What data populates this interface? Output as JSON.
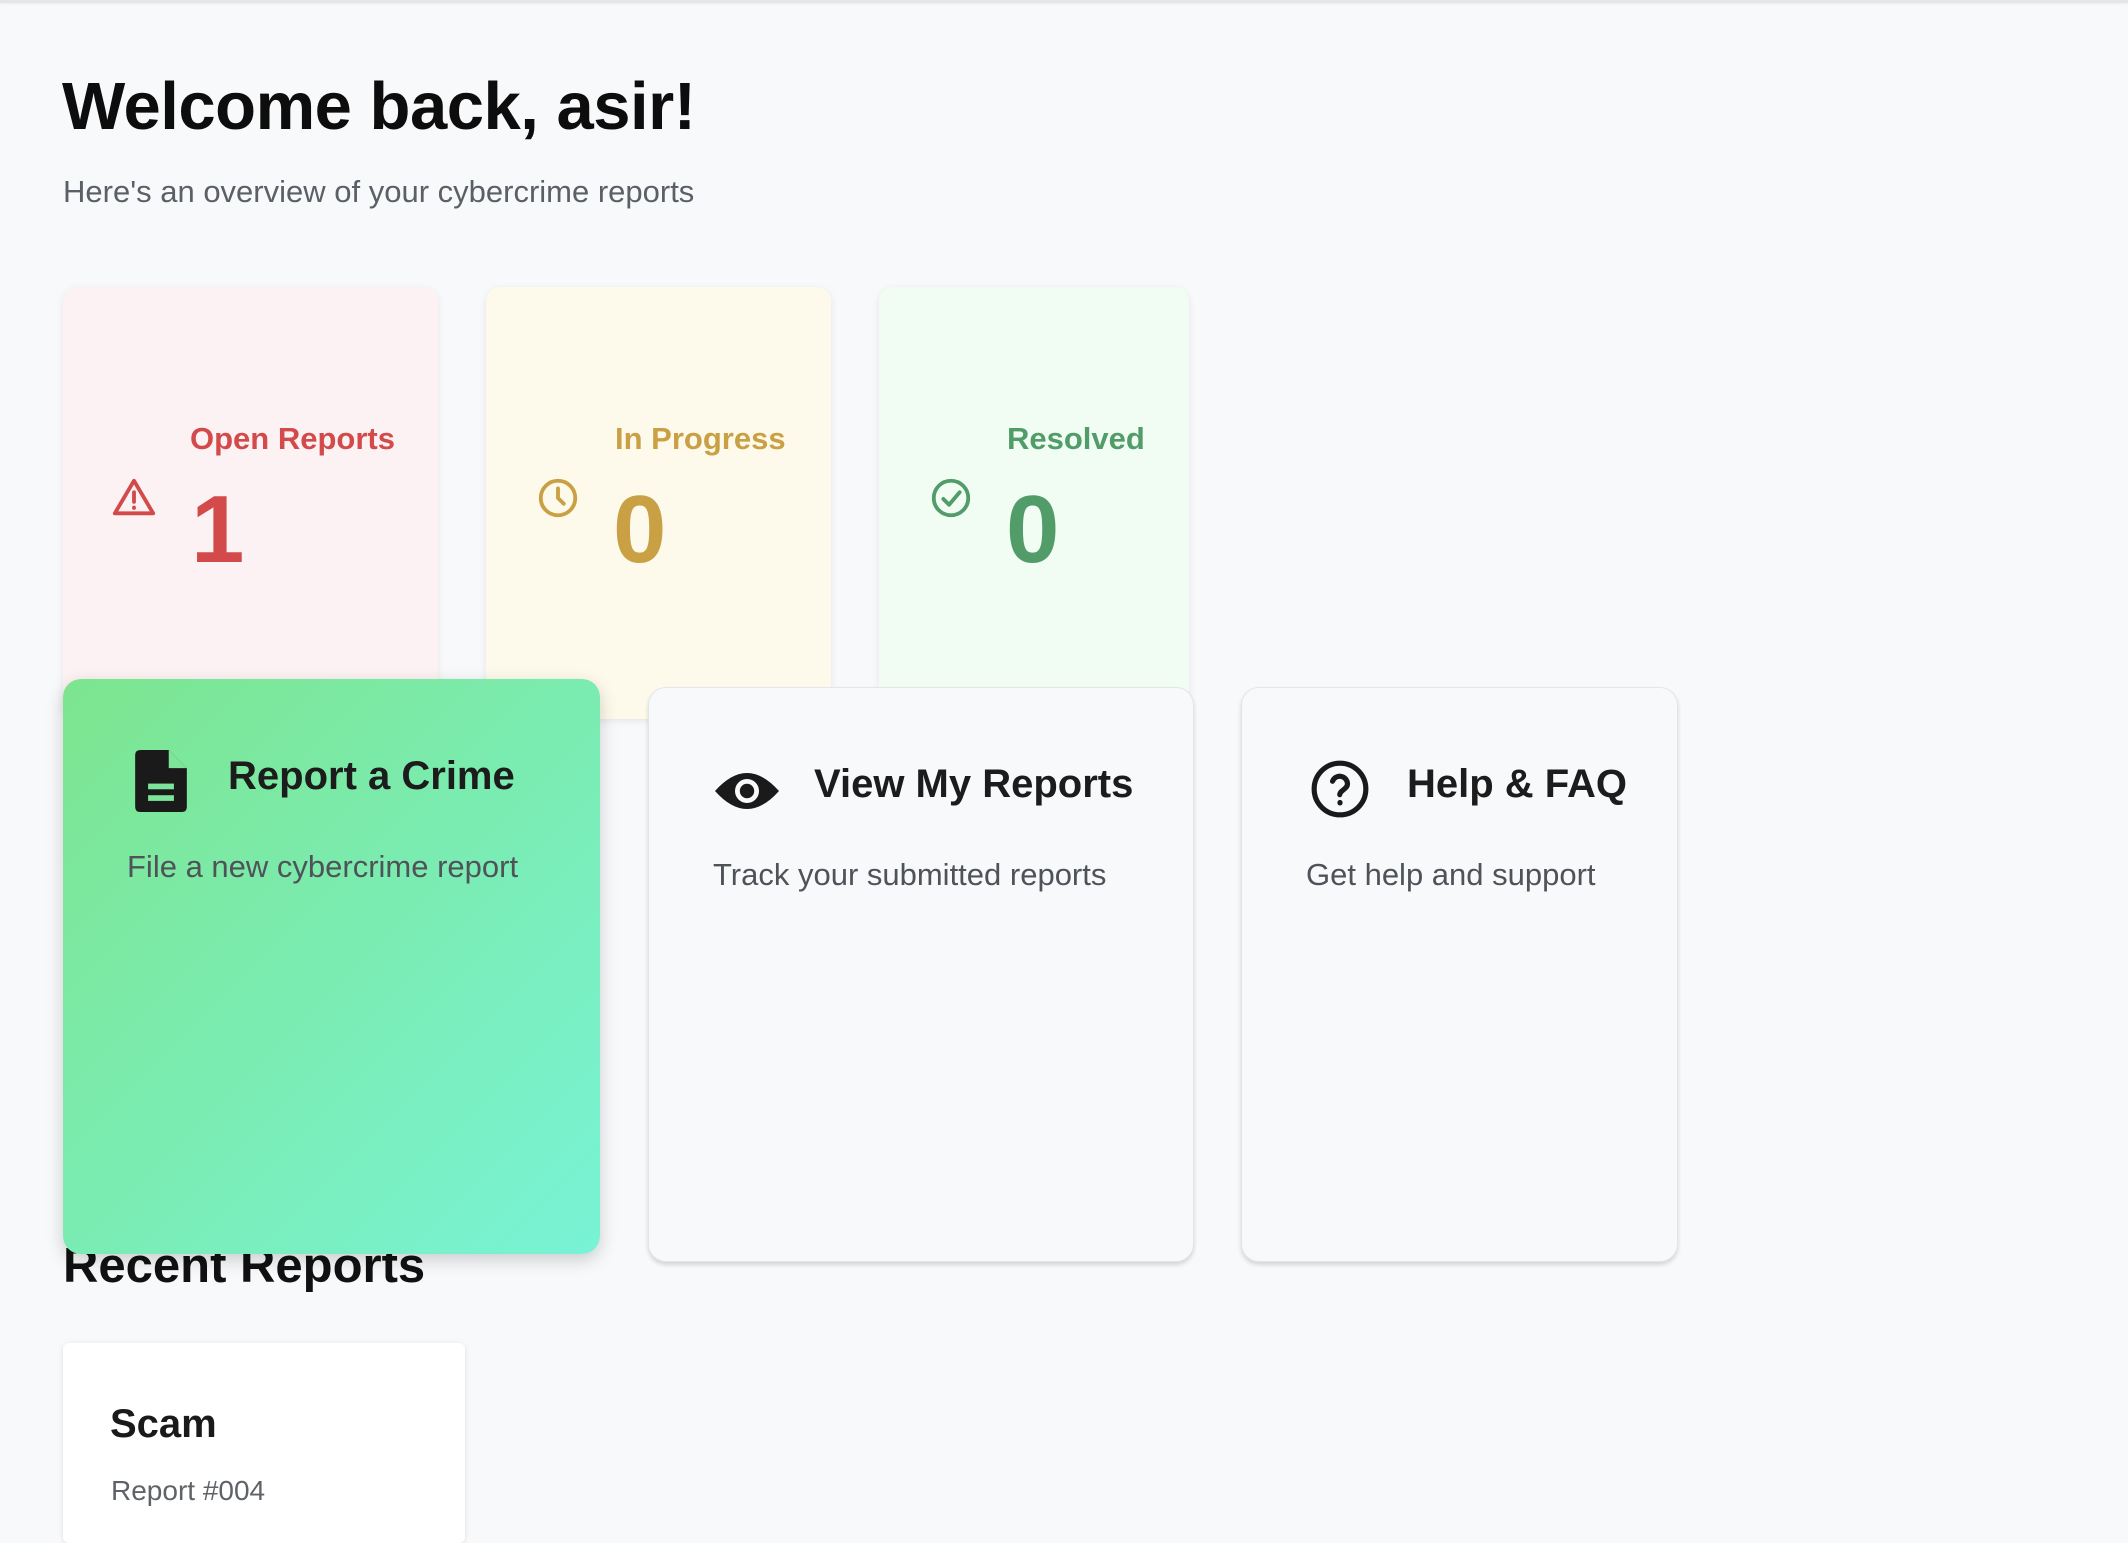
{
  "header": {
    "title": "Welcome back, asir!",
    "subtitle": "Here's an overview of your cybercrime reports"
  },
  "stats": [
    {
      "label": "Open Reports",
      "value": "1",
      "icon": "warning-triangle-icon",
      "color": "#d24a4a"
    },
    {
      "label": "In Progress",
      "value": "0",
      "icon": "clock-icon",
      "color": "#c9a044"
    },
    {
      "label": "Resolved",
      "value": "0",
      "icon": "check-circle-icon",
      "color": "#529c6a"
    }
  ],
  "actions": [
    {
      "title": "Report a Crime",
      "description": "File a new cybercrime report",
      "icon": "document-icon"
    },
    {
      "title": "View My Reports",
      "description": "Track your submitted reports",
      "icon": "eye-icon"
    },
    {
      "title": "Help & FAQ",
      "description": "Get help and support",
      "icon": "help-circle-icon"
    }
  ],
  "recent": {
    "title": "Recent Reports",
    "items": [
      {
        "title": "Scam",
        "id": "Report #004"
      }
    ]
  },
  "colors": {
    "background": "#f8f9fb",
    "report_gradient_start": "#7de58f",
    "report_gradient_end": "#78f3d5"
  }
}
